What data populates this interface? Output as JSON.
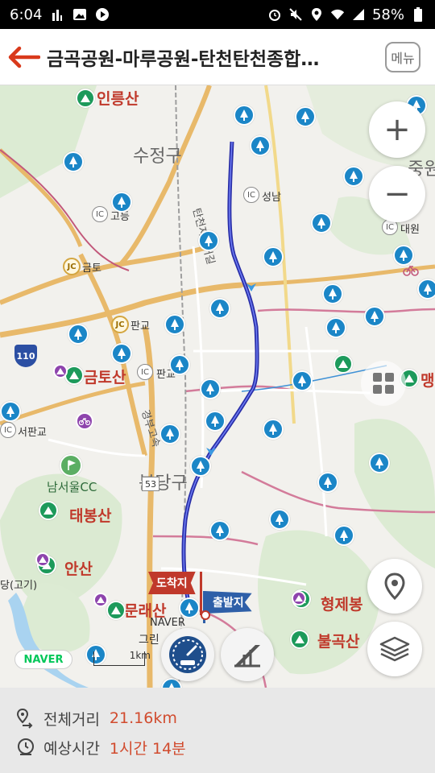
{
  "status_bar": {
    "time": "6:04",
    "battery": "58%",
    "left_icons": [
      "signal-bars-icon",
      "image-icon",
      "play-icon"
    ],
    "right_icons": [
      "alarm-icon",
      "mute-icon",
      "location-icon",
      "wifi-icon",
      "cell-signal-icon",
      "battery-icon"
    ]
  },
  "header": {
    "title": "금곡공원-마루공원-탄천탄천종합…",
    "menu_label": "메뉴",
    "back_icon": "back-arrow-icon"
  },
  "map": {
    "region_labels": [
      "수정구",
      "중원",
      "분당구"
    ],
    "mountains": [
      "인릉산",
      "금토산",
      "태봉산",
      "안산",
      "문래산",
      "형제봉",
      "불곡산",
      "맹"
    ],
    "places": [
      "남서울CC",
      "당(고기)",
      "NAVER",
      "그린"
    ],
    "interchanges": [
      {
        "type": "IC",
        "name": "고등"
      },
      {
        "type": "IC",
        "name": "성남"
      },
      {
        "type": "IC",
        "name": "대원"
      },
      {
        "type": "JC",
        "name": "금토"
      },
      {
        "type": "JC",
        "name": "판교"
      },
      {
        "type": "IC",
        "name": "판교"
      },
      {
        "type": "IC",
        "name": "서판교"
      }
    ],
    "highway_shield": "110",
    "route_label_road": "탄천자전거길",
    "road_label_2": "경부고속",
    "bridge_label": "53",
    "destination_flag": "도착지",
    "start_flag": "출발지",
    "naver_logo": "NAVER",
    "scale_label": "1km",
    "buttons": {
      "zoom_in": "+",
      "zoom_out": "−"
    },
    "colors": {
      "route": "#2a2fa8",
      "pin_blue": "#1b86c7",
      "pin_green": "#1d9a5b",
      "mountain_text": "#c0392b"
    }
  },
  "info": {
    "distance_label": "전체거리",
    "distance_value": "21.16km",
    "time_label": "예상시간",
    "time_value": "1시간 14분"
  }
}
